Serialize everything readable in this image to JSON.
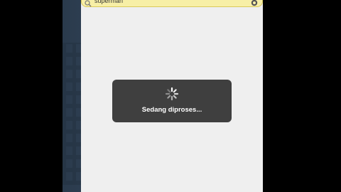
{
  "search": {
    "query": "superman",
    "search_icon": "search-icon",
    "settings_icon": "gear-icon"
  },
  "loading": {
    "message": "Sedang diproses...",
    "icon": "spinner-icon"
  },
  "colors": {
    "search_bar_bg": "#f7efa6",
    "screen_bg": "#efefef",
    "loading_bg": "#323232",
    "backdrop": "#34475b"
  }
}
